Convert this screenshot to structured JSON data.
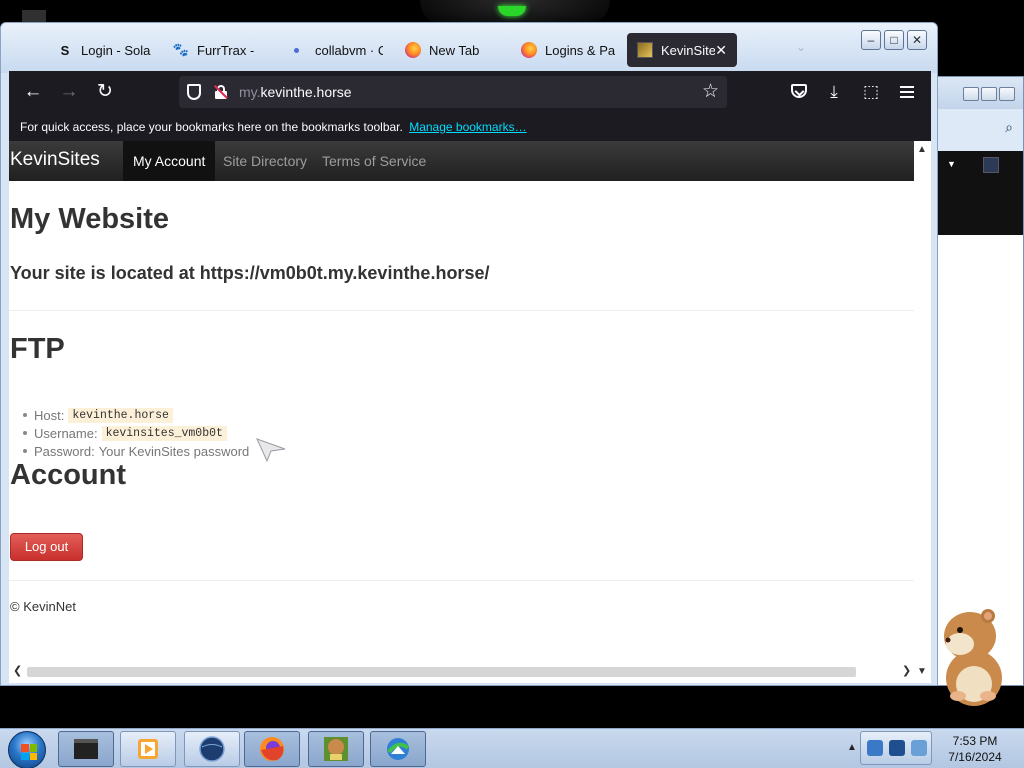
{
  "browser": {
    "tabs": [
      {
        "label": "Login - Solar",
        "favicon": "s-logo-icon"
      },
      {
        "label": "FurrTrax -",
        "favicon": "paw-icon"
      },
      {
        "label": "collabvm · Ch",
        "favicon": "dot-icon"
      },
      {
        "label": "New Tab",
        "favicon": "firefox-icon"
      },
      {
        "label": "Logins & Pass",
        "favicon": "firefox-icon"
      },
      {
        "label": "KevinSites",
        "favicon": "kevinsites-icon",
        "active": true
      }
    ],
    "url_prefix": "my.",
    "url_domain": "kevinthe.horse",
    "bookmarks_message": "For quick access, place your bookmarks here on the bookmarks toolbar.",
    "bookmarks_link": "Manage bookmarks…"
  },
  "site": {
    "brand": "KevinSites",
    "nav": [
      {
        "label": "My Account",
        "active": true
      },
      {
        "label": "Site Directory"
      },
      {
        "label": "Terms of Service"
      }
    ],
    "website_heading": "My Website",
    "site_location": "Your site is located at https://vm0b0t.my.kevinthe.horse/",
    "ftp_heading": "FTP",
    "ftp": {
      "host_label": "Host:",
      "host_value": "kevinthe.horse",
      "username_label": "Username:",
      "username_value": "kevinsites_vm0b0t",
      "password_label": "Password:",
      "password_value": "Your KevinSites password"
    },
    "account_heading": "Account",
    "logout_label": "Log out",
    "footer": "© KevinNet"
  },
  "taskbar": {
    "time": "7:53 PM",
    "date": "7/16/2024"
  },
  "colors": {
    "logout_button": "#d9534f",
    "navbar_bg": "#222222",
    "browser_chrome": "#1c1b22",
    "link": "#00ddff"
  }
}
